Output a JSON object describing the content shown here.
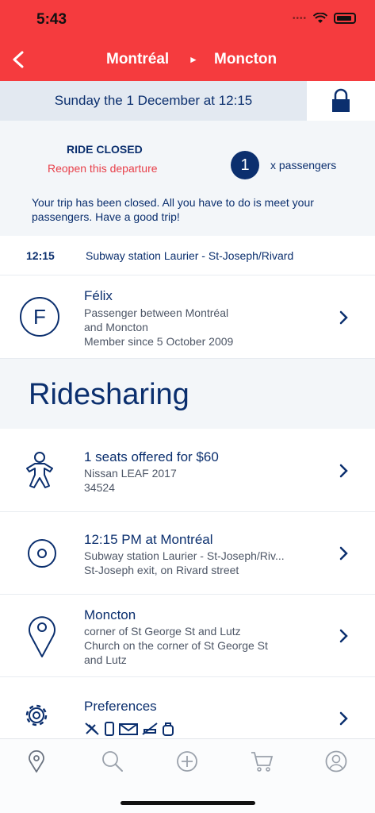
{
  "status": {
    "time": "5:43"
  },
  "nav": {
    "from": "Montréal",
    "arrow": "►",
    "to": "Moncton"
  },
  "date": {
    "label": "Sunday the 1 December at 12:15"
  },
  "closed": {
    "title": "RIDE CLOSED",
    "reopen": "Reopen this departure",
    "passenger_count": "1",
    "passenger_label": "x passengers",
    "message": "Your trip has been closed. All you have to do is meet your passengers. Have a good trip!"
  },
  "stop": {
    "time": "12:15",
    "station": "Subway station Laurier - St-Joseph/Rivard"
  },
  "passenger": {
    "initial": "F",
    "name": "Félix",
    "line1": "Passenger between Montréal",
    "line2": "and Moncton",
    "line3": "Member since 5 October 2009"
  },
  "section": {
    "title": "Ridesharing"
  },
  "seats": {
    "title": "1 seats offered for $60",
    "line1": "Nissan LEAF 2017",
    "line2": "34524"
  },
  "departure": {
    "title": "12:15 PM at Montréal",
    "line1": "Subway station Laurier - St-Joseph/Riv...",
    "line2": "St-Joseph exit, on Rivard street"
  },
  "arrival": {
    "title": "Moncton",
    "line1": "corner of St George St and Lutz",
    "line2": "Church on the corner of St George St",
    "line3": "and Lutz"
  },
  "prefs": {
    "title": "Preferences"
  },
  "colors": {
    "brand_red": "#f53b3e",
    "navy": "#0b2f6e",
    "link_red": "#e8404a"
  },
  "tabs": [
    "location-pin-icon",
    "search-icon",
    "add-circle-icon",
    "cart-icon",
    "profile-icon"
  ]
}
